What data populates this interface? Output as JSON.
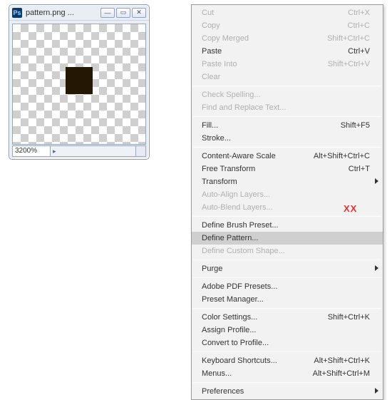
{
  "window": {
    "title": "pattern.png ...",
    "zoom": "3200%",
    "ps_icon_text": "Ps"
  },
  "xx": "XX",
  "menu": {
    "groups": [
      [
        {
          "label": "Cut",
          "shortcut": "Ctrl+X",
          "disabled": true
        },
        {
          "label": "Copy",
          "shortcut": "Ctrl+C",
          "disabled": true
        },
        {
          "label": "Copy Merged",
          "shortcut": "Shift+Ctrl+C",
          "disabled": true
        },
        {
          "label": "Paste",
          "shortcut": "Ctrl+V"
        },
        {
          "label": "Paste Into",
          "shortcut": "Shift+Ctrl+V",
          "disabled": true
        },
        {
          "label": "Clear",
          "disabled": true
        }
      ],
      [
        {
          "label": "Check Spelling...",
          "disabled": true
        },
        {
          "label": "Find and Replace Text...",
          "disabled": true
        }
      ],
      [
        {
          "label": "Fill...",
          "shortcut": "Shift+F5"
        },
        {
          "label": "Stroke..."
        }
      ],
      [
        {
          "label": "Content-Aware Scale",
          "shortcut": "Alt+Shift+Ctrl+C"
        },
        {
          "label": "Free Transform",
          "shortcut": "Ctrl+T"
        },
        {
          "label": "Transform",
          "submenu": true
        },
        {
          "label": "Auto-Align Layers...",
          "disabled": true
        },
        {
          "label": "Auto-Blend Layers...",
          "disabled": true
        }
      ],
      [
        {
          "label": "Define Brush Preset..."
        },
        {
          "label": "Define Pattern...",
          "highlight": true
        },
        {
          "label": "Define Custom Shape...",
          "disabled": true
        }
      ],
      [
        {
          "label": "Purge",
          "submenu": true
        }
      ],
      [
        {
          "label": "Adobe PDF Presets..."
        },
        {
          "label": "Preset Manager..."
        }
      ],
      [
        {
          "label": "Color Settings...",
          "shortcut": "Shift+Ctrl+K"
        },
        {
          "label": "Assign Profile..."
        },
        {
          "label": "Convert to Profile..."
        }
      ],
      [
        {
          "label": "Keyboard Shortcuts...",
          "shortcut": "Alt+Shift+Ctrl+K"
        },
        {
          "label": "Menus...",
          "shortcut": "Alt+Shift+Ctrl+M"
        }
      ],
      [
        {
          "label": "Preferences",
          "submenu": true
        }
      ]
    ]
  }
}
